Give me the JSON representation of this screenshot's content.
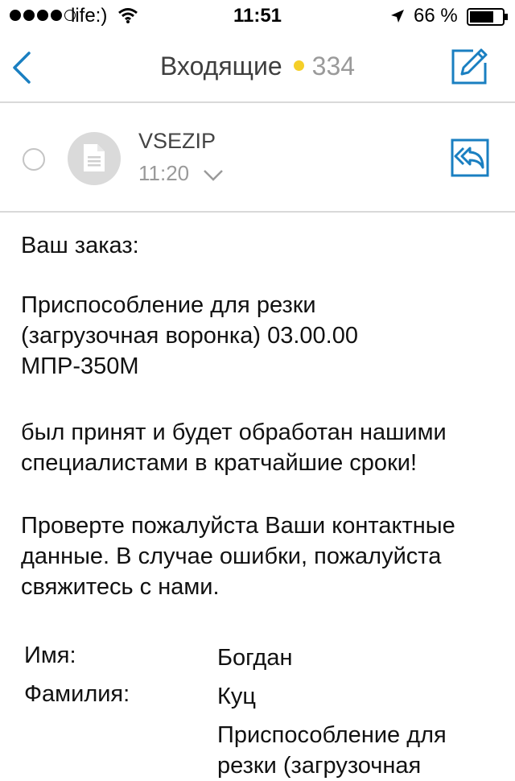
{
  "status_bar": {
    "carrier": "life:)",
    "time": "11:51",
    "battery": "66 %"
  },
  "nav": {
    "title": "Входящие",
    "unread_count": "334"
  },
  "message": {
    "sender": "VSEZIP",
    "time": "11:20",
    "paragraphs": [
      "Ваш заказ:",
      "Приспособление для резки (загрузочная воронка) 03.00.00 МПР-350М",
      "был принят и будет обработан нашими специалистами в кратчайшие сроки!",
      "Проверте пожалуйста Ваши контактные данные. В случае ошибки, пожалуйста свяжитесь с нами."
    ],
    "fields": [
      {
        "label": "Имя:",
        "value": "Богдан"
      },
      {
        "label": "Фамилия:",
        "value": "Куц"
      },
      {
        "label": "",
        "value": "Приспособление для резки (загрузочная"
      }
    ]
  },
  "colors": {
    "accent": "#1a7fc1",
    "unread_dot": "#f5cf28",
    "divider": "#d9d9d9"
  }
}
